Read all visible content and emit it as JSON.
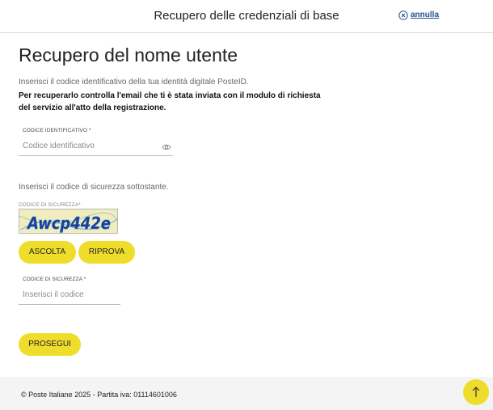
{
  "header": {
    "title": "Recupero delle credenziali di base",
    "cancel_label": "annulla"
  },
  "main": {
    "title": "Recupero del nome utente",
    "intro": "Inserisci il codice identificativo della tua identità digitale PosteID.",
    "intro_bold": "Per recuperarlo controlla l'email che ti è stata inviata con il modulo di richiesta del servizio all'atto della registrazione.",
    "id_field": {
      "label": "CODICE IDENTIFICATIVO *",
      "placeholder": "Codice identificativo",
      "value": ""
    },
    "security_intro": "Inserisci il codice di sicurezza sottostante.",
    "captcha": {
      "label": "CODICE DI SICUREZZA*",
      "text": "Awcp442e"
    },
    "listen_label": "ASCOLTA",
    "retry_label": "RIPROVA",
    "security_field": {
      "label": "CODICE DI SICUREZZA *",
      "placeholder": "Inserisci il codice",
      "value": ""
    },
    "continue_label": "PROSEGUI"
  },
  "footer": {
    "text": "© Poste Italiane 2025 - Partita iva: 01114601006"
  },
  "colors": {
    "accent": "#efdd2c",
    "link": "#1f4f8f",
    "footer_bg": "#f4f4f4"
  },
  "icons": {
    "cancel": "close-circle-icon",
    "reveal": "eye-icon",
    "scroll_top": "arrow-up-icon"
  }
}
